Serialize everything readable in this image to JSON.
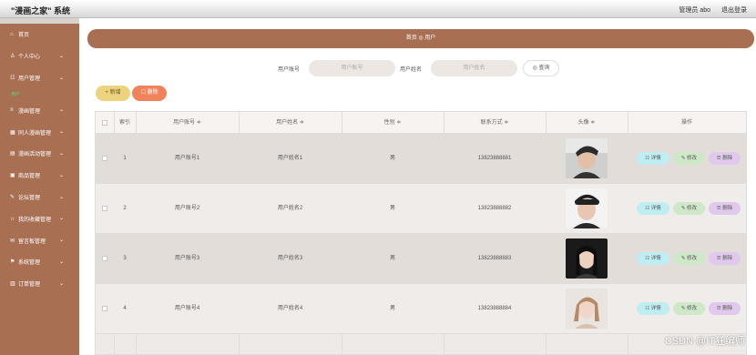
{
  "app": {
    "title": "\"漫画之家\" 系统",
    "user": "管理员 abo",
    "logout": "退出登录"
  },
  "sidebar": {
    "items": [
      {
        "label": "首页",
        "icon": "home-icon",
        "glyph": "⌂"
      },
      {
        "label": "个人中心",
        "icon": "user-icon",
        "glyph": "♙",
        "chev": "⌄"
      },
      {
        "label": "用户管理",
        "icon": "users-icon",
        "glyph": "☷",
        "chev": "⌄"
      },
      {
        "label": "漫画管理",
        "icon": "book-icon",
        "glyph": "≡",
        "chev": "⌄"
      },
      {
        "label": "同人漫画管理",
        "icon": "grid-icon",
        "glyph": "▦",
        "chev": "⌄"
      },
      {
        "label": "漫画活动管理",
        "icon": "activity-icon",
        "glyph": "▤",
        "chev": "⌄"
      },
      {
        "label": "商品管理",
        "icon": "goods-icon",
        "glyph": "▣",
        "chev": "⌄"
      },
      {
        "label": "论坛管理",
        "icon": "forum-icon",
        "glyph": "✎",
        "chev": "⌄"
      },
      {
        "label": "我的收藏管理",
        "icon": "star-icon",
        "glyph": "☆",
        "chev": "⌄"
      },
      {
        "label": "留言板管理",
        "icon": "message-icon",
        "glyph": "✉",
        "chev": "⌄"
      },
      {
        "label": "系统管理",
        "icon": "flag-icon",
        "glyph": "⚑",
        "chev": "⌄"
      },
      {
        "label": "订单管理",
        "icon": "order-icon",
        "glyph": "▥",
        "chev": "⌄"
      }
    ],
    "sub_active": "用户"
  },
  "breadcrumb": {
    "text": "首页 ◎ 用户"
  },
  "search": {
    "account_label": "用户账号",
    "account_placeholder": "用户账号",
    "name_label": "用户姓名",
    "name_placeholder": "用户姓名",
    "button": "◎ 查询"
  },
  "toolbar": {
    "add": "+ 新增",
    "delete": "☐ 删除"
  },
  "table": {
    "headers": [
      "索引",
      "用户账号 ≑",
      "用户姓名 ≑",
      "性别 ≑",
      "联系方式 ≑",
      "头像 ≑",
      "操作"
    ],
    "rows": [
      {
        "index": "1",
        "account": "用户账号1",
        "name": "用户姓名1",
        "gender": "男",
        "phone": "13823888881"
      },
      {
        "index": "2",
        "account": "用户账号2",
        "name": "用户姓名2",
        "gender": "男",
        "phone": "13823888882"
      },
      {
        "index": "3",
        "account": "用户账号3",
        "name": "用户姓名3",
        "gender": "男",
        "phone": "13823888883"
      },
      {
        "index": "4",
        "account": "用户账号4",
        "name": "用户姓名4",
        "gender": "男",
        "phone": "13823888884"
      }
    ],
    "actions": {
      "detail": "☷ 详情",
      "edit": "✎ 修改",
      "delete": "☰ 删除"
    }
  },
  "watermark": "CSDN @IT狂编师"
}
